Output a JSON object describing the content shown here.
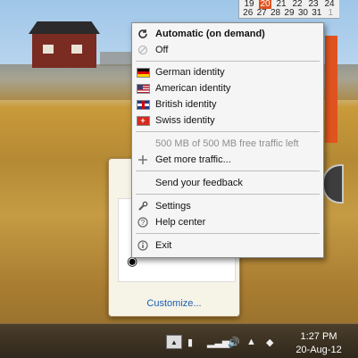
{
  "calendar": {
    "row1": [
      "19",
      "20",
      "21",
      "22",
      "23",
      "24"
    ],
    "row2": [
      "26",
      "27",
      "28",
      "29",
      "30",
      "31",
      "1"
    ],
    "today": "20"
  },
  "menu": {
    "automatic": "Automatic (on demand)",
    "off": "Off",
    "identities": [
      {
        "label": "German identity",
        "flag": "de"
      },
      {
        "label": "American identity",
        "flag": "us"
      },
      {
        "label": "British identity",
        "flag": "gb"
      },
      {
        "label": "Swiss identity",
        "flag": "ch"
      }
    ],
    "traffic_status": "500 MB of 500 MB free traffic left",
    "get_more": "Get more traffic...",
    "feedback": "Send your feedback",
    "settings": "Settings",
    "help": "Help center",
    "exit": "Exit"
  },
  "tray_popup": {
    "customize": "Customize..."
  },
  "taskbar": {
    "time": "1:27 PM",
    "date": "20-Aug-12"
  },
  "icons": {
    "automatic": "refresh-icon",
    "off": "off-icon",
    "get_more": "plus-icon",
    "settings": "wrench-icon",
    "help": "question-icon",
    "exit": "info-icon"
  },
  "colors": {
    "accent": "#e0531f",
    "link": "#1a5fb4"
  }
}
